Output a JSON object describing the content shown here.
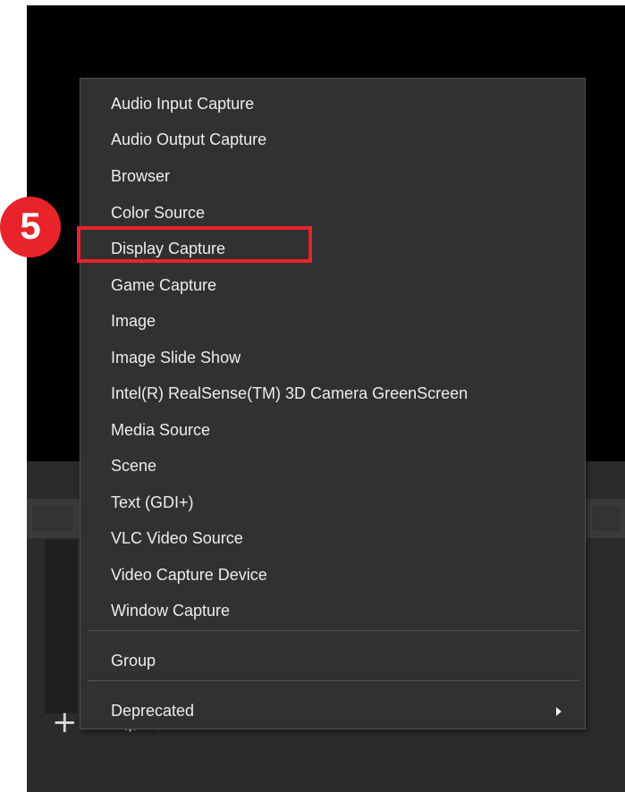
{
  "add_source_menu": {
    "items": [
      {
        "label": "Audio Input Capture"
      },
      {
        "label": "Audio Output Capture"
      },
      {
        "label": "Browser"
      },
      {
        "label": "Color Source"
      },
      {
        "label": "Display Capture"
      },
      {
        "label": "Game Capture"
      },
      {
        "label": "Image"
      },
      {
        "label": "Image Slide Show"
      },
      {
        "label": "Intel(R) RealSense(TM) 3D Camera GreenScreen"
      },
      {
        "label": "Media Source"
      },
      {
        "label": "Scene"
      },
      {
        "label": "Text (GDI+)"
      },
      {
        "label": "VLC Video Source"
      },
      {
        "label": "Video Capture Device"
      },
      {
        "label": "Window Capture"
      }
    ],
    "group_label": "Group",
    "deprecated_label": "Deprecated",
    "highlighted_item": "Display Capture"
  },
  "annotation": {
    "step_number": "5",
    "color": "#e8232a"
  },
  "toolbar": {
    "add_icon": "plus-icon",
    "remove_icon": "minus-icon",
    "settings_icon": "gear-icon",
    "up_icon": "chevron-up-icon",
    "down_icon": "chevron-down-icon"
  },
  "colors": {
    "menu_bg": "#313131",
    "menu_text": "#ededed",
    "preview_bg": "#000000",
    "panel_bg": "#2b2b2b"
  }
}
